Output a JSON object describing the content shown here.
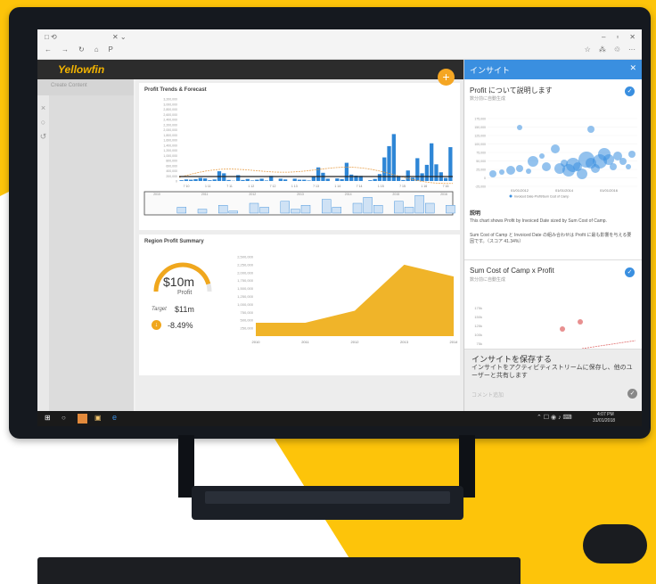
{
  "browser": {
    "tab_icons": "□ ⟲",
    "tab_controls": "✕ ⌄",
    "address": "P",
    "window_controls": [
      "–",
      "▫",
      "✕"
    ],
    "toolbar_icons": [
      "☆",
      "⁂",
      "♲",
      "···"
    ]
  },
  "app": {
    "logo": "Yellowfin",
    "search_placeholder": "Create Content",
    "add_button": "+"
  },
  "trend_card": {
    "title": "Profit Trends & Forecast",
    "chart_data": {
      "type": "bar",
      "y_ticks": [
        "3,200,000",
        "3,000,000",
        "2,800,000",
        "2,600,000",
        "2,400,000",
        "2,200,000",
        "2,000,000",
        "1,800,000",
        "1,600,000",
        "1,400,000",
        "1,200,000",
        "1,000,000",
        "800,000",
        "600,000",
        "400,000",
        "200,000",
        "0"
      ],
      "x_ticks": [
        "7 10",
        "1 11",
        "7 11",
        "1 12",
        "7 12",
        "1 13",
        "7 13",
        "1 14",
        "7 14",
        "1 15",
        "7 15",
        "1 16",
        "7 16"
      ],
      "values": [
        30000,
        60000,
        50000,
        70000,
        120000,
        100000,
        30000,
        60000,
        380000,
        300000,
        40000,
        10000,
        230000,
        40000,
        80000,
        20000,
        50000,
        90000,
        20000,
        200000,
        0,
        90000,
        60000,
        0,
        90000,
        50000,
        50000,
        20000,
        170000,
        530000,
        320000,
        90000,
        0,
        100000,
        70000,
        710000,
        250000,
        210000,
        200000,
        0,
        30000,
        80000,
        270000,
        920000,
        1360000,
        1830000,
        200000,
        40000,
        410000,
        130000,
        890000,
        300000,
        630000,
        1470000,
        650000,
        340000,
        120000,
        1320000
      ],
      "ylim": [
        0,
        3200000
      ],
      "bar_color": "#2e86d6",
      "forecast_color": "#e8a04b"
    },
    "navigator_years": [
      "2010",
      "2011",
      "2012",
      "2013",
      "2014",
      "2015",
      "2016"
    ]
  },
  "region_card": {
    "title": "Region Profit Summary",
    "gauge_value": "$10m",
    "gauge_label": "Profit",
    "target_label": "Target",
    "target_value": "$11m",
    "change_value": "-8.49%",
    "gauge_fill": 0.91,
    "chart_data": {
      "type": "area",
      "x": [
        2010,
        2011,
        2012,
        2013,
        2014
      ],
      "y_ticks": [
        "2,500,000",
        "2,250,000",
        "2,000,000",
        "1,750,000",
        "1,500,000",
        "1,250,000",
        "1,000,000",
        "750,000",
        "500,000",
        "250,000"
      ],
      "series": [
        {
          "values": [
            420000,
            420000,
            800000,
            2250000,
            1880000
          ]
        }
      ],
      "ylim": [
        0,
        2500000
      ],
      "xlim": [
        2010,
        2014
      ],
      "color": "#f0b429"
    }
  },
  "insight_panel": {
    "header": "インサイト",
    "close": "✕",
    "card1_title": "Profit について説明します",
    "card1_sub": "数分前に自動生成",
    "card1_chart": {
      "type": "scatter",
      "y_ticks": [
        "175,000",
        "150,000",
        "125,000",
        "100,000",
        "75,000",
        "50,000",
        "25,000",
        "0",
        "-25,000"
      ],
      "x_ticks": [
        "01/01/2012",
        "01/01/2014",
        "01/01/2016"
      ],
      "legend": "Invoiced Date-Profit/Sum Cost of Camp"
    },
    "explain_heading": "説明",
    "explain_text_1": "This chart shows Profit by Invoiced Date sized by Sum Cost of Camp.",
    "explain_text_2": "Sum Cost of Camp と Invoiced Date の組み合わせは Profit に最も影響を与える要因です。（スコア 41.34%）",
    "card2_title": "Sum Cost of Camp x Profit",
    "card2_sub": "数分前に自動生成",
    "card2_ticks": [
      "175k",
      "150k",
      "125k",
      "100k",
      "75k"
    ],
    "save_title": "インサイトを保存する",
    "save_text": "インサイトをアクティビティストリームに保存し、他のユーザーと共有します",
    "comment_placeholder": "コメント追加",
    "check": "✓"
  },
  "taskbar": {
    "clock_time": "4:07 PM",
    "clock_date": "31/01/2018"
  }
}
